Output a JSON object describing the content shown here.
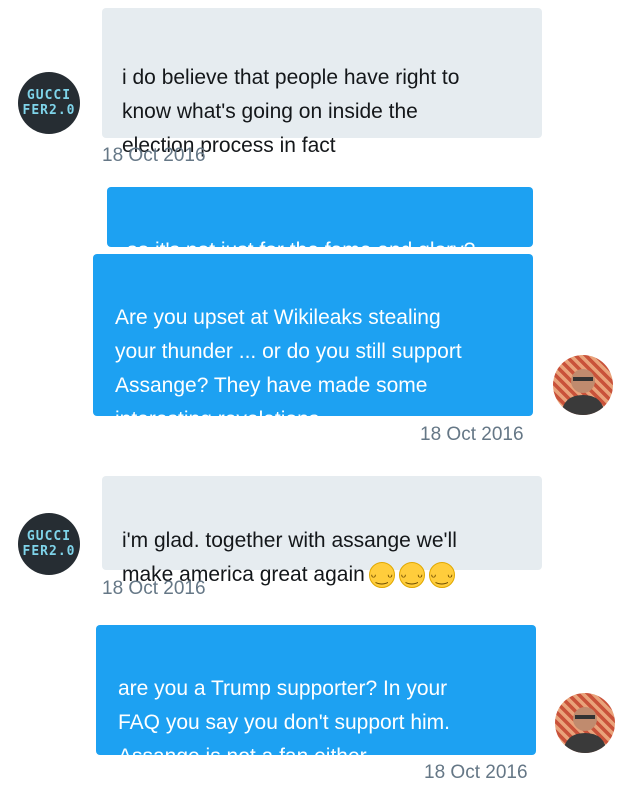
{
  "conversation": {
    "gucci_avatar": {
      "line1": "GUCCI",
      "line2": "FER2.0"
    },
    "messages": [
      {
        "direction": "in",
        "text": "i do believe that people have right to\nknow what's going on inside the\nelection process in fact",
        "timestamp": "18 Oct 2016"
      },
      {
        "direction": "out",
        "text": "so it's not just for the fame and glory?"
      },
      {
        "direction": "out",
        "text": "Are you upset at Wikileaks stealing\nyour thunder ... or do you still support\nAssange? They have made some\ninteresting revelations",
        "timestamp": "18 Oct 2016"
      },
      {
        "direction": "in",
        "text": "i'm glad. together with assange we'll\nmake america great again",
        "emoji": [
          "grinning-face",
          "grinning-face",
          "grinning-face"
        ],
        "timestamp": "18 Oct 2016"
      },
      {
        "direction": "out",
        "text": "are you a Trump supporter? In your\nFAQ you say you don't support him.\nAssange is not a fan either.",
        "timestamp": "18 Oct 2016"
      }
    ]
  },
  "icons": {
    "emoji": "grinning-face-emoji",
    "user_avatar": "user-avatar-photo"
  },
  "colors": {
    "incoming_bubble": "#e6ecf0",
    "outgoing_bubble": "#1da1f2",
    "timestamp": "#657786"
  }
}
